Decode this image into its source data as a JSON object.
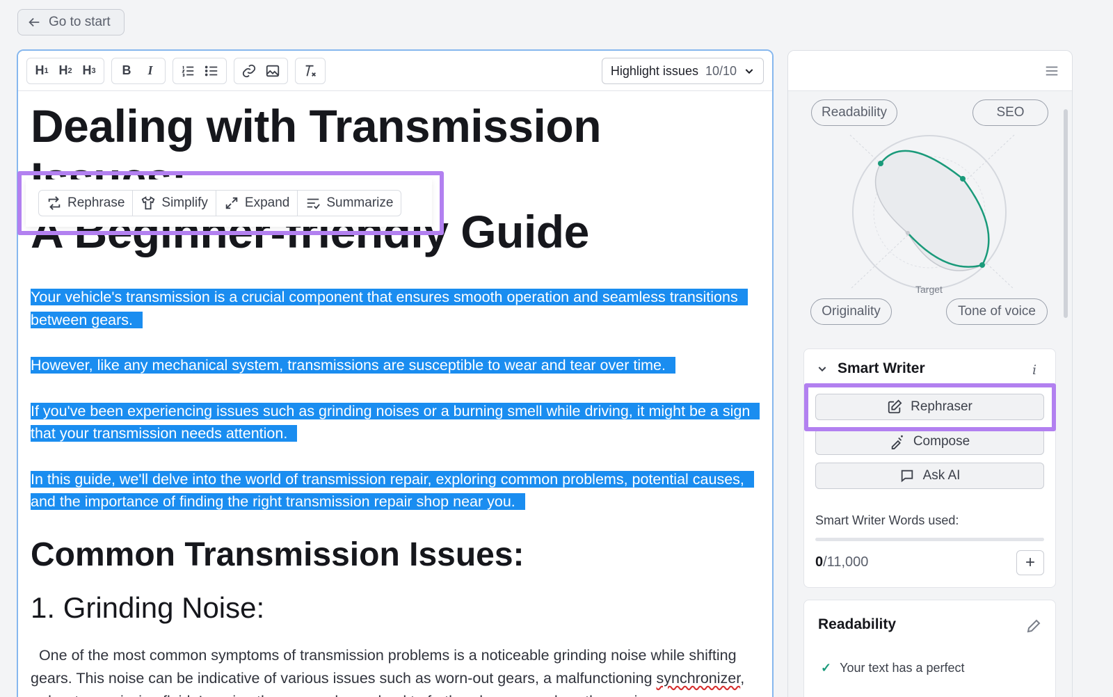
{
  "nav": {
    "back_label": "Go to start"
  },
  "toolbar": {
    "headings": [
      {
        "label": "H",
        "level": "1"
      },
      {
        "label": "H",
        "level": "2"
      },
      {
        "label": "H",
        "level": "3"
      }
    ],
    "bold": "B",
    "italic": "I",
    "highlight_label": "Highlight issues",
    "highlight_count": "10/10"
  },
  "ai_toolbar": {
    "rephrase": "Rephrase",
    "simplify": "Simplify",
    "expand": "Expand",
    "summarize": "Summarize"
  },
  "document": {
    "title_line1": "Dealing with Transmission Issues:",
    "title_line2": "A Beginner-friendly Guide",
    "selected_paragraphs": [
      "Your vehicle's transmission is a crucial component that ensures smooth operation and seamless transitions between gears.",
      "However, like any mechanical system, transmissions are susceptible to wear and tear over time.",
      "If you've been experiencing issues such as grinding noises or a burning smell while driving, it might be a sign that your transmission needs attention.",
      "In this guide, we'll delve into the world of transmission repair, exploring common problems, potential causes, and the importance of finding the right transmission repair shop near you."
    ],
    "heading2": "Common Transmission Issues:",
    "heading3": "1. Grinding Noise:",
    "body_before": "One of the most common symptoms of transmission problems is a noticeable grinding noise while shifting gears. This noise can be indicative of various issues such as worn-out gears, a malfunctioning ",
    "body_misspelled": "synchronizer",
    "body_after": ", or low transmission fluid. Ignoring these sounds can lead to further damage and costly repairs."
  },
  "panel": {
    "metrics": {
      "readability": "Readability",
      "seo": "SEO",
      "originality": "Originality",
      "tone": "Tone of voice",
      "target_label": "Target"
    },
    "smart_writer": {
      "title": "Smart Writer",
      "info": "i",
      "rephraser": "Rephraser",
      "compose": "Compose",
      "ask_ai": "Ask AI",
      "words_label": "Smart Writer Words used:",
      "words_used": "0",
      "words_limit": "/11,000",
      "words_progress": 0,
      "add": "+"
    },
    "readability_card": {
      "title": "Readability",
      "item": "Your text has a perfect"
    }
  },
  "colors": {
    "selection": "#1a8df0",
    "callout": "#b280f0",
    "radar_line": "#1a9a7a",
    "editor_border": "#86b7ee"
  }
}
